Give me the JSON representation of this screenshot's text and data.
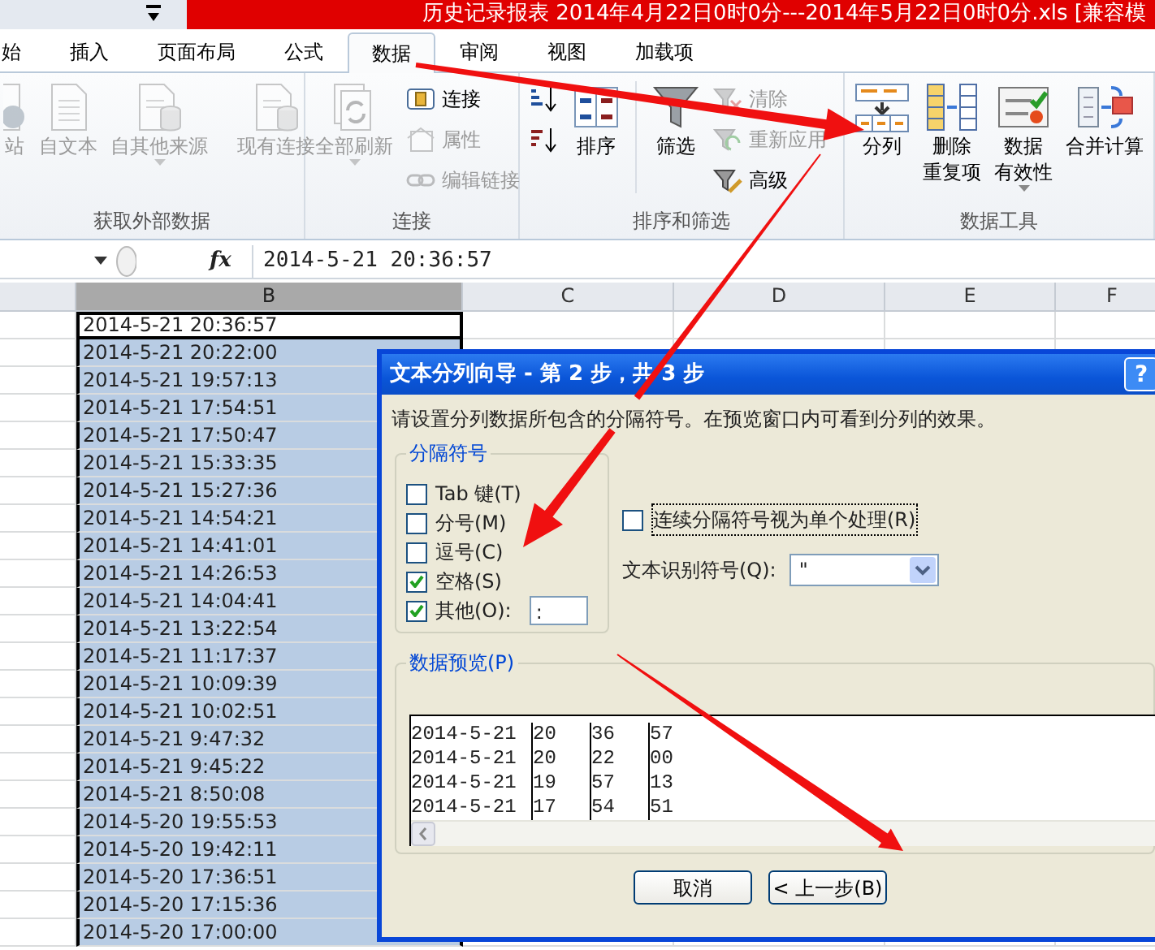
{
  "title_bar": {
    "title": "历史记录报表 2014年4月22日0时0分---2014年5月22日0时0分.xls",
    "mode": "[兼容模"
  },
  "tabs": [
    {
      "label": "始",
      "selected": false
    },
    {
      "label": "插入",
      "selected": false
    },
    {
      "label": "页面布局",
      "selected": false
    },
    {
      "label": "公式",
      "selected": false
    },
    {
      "label": "数据",
      "selected": true
    },
    {
      "label": "审阅",
      "selected": false
    },
    {
      "label": "视图",
      "selected": false
    },
    {
      "label": "加载项",
      "selected": false
    }
  ],
  "ribbon_groups": [
    {
      "title": "获取外部数据",
      "items": [
        {
          "kind": "large",
          "lines": [
            "站"
          ],
          "disabled": true
        },
        {
          "kind": "large",
          "lines": [
            "自文本"
          ],
          "disabled": true
        },
        {
          "kind": "large",
          "lines": [
            "自其他来源"
          ],
          "disabled": true,
          "dropdown": true
        },
        {
          "kind": "separator"
        },
        {
          "kind": "large",
          "lines": [
            "现有连接"
          ],
          "disabled": true
        }
      ]
    },
    {
      "title": "连接",
      "items": [
        {
          "kind": "large",
          "lines": [
            "全部刷新"
          ],
          "disabled": true,
          "dropdown": true
        },
        {
          "kind": "stack",
          "items": [
            {
              "label": "连接",
              "disabled": false
            },
            {
              "label": "属性",
              "disabled": true
            },
            {
              "label": "编辑链接",
              "disabled": true
            }
          ]
        }
      ]
    },
    {
      "title": "排序和筛选",
      "items": [
        {
          "kind": "stack",
          "items": [
            {
              "disabled": false
            },
            {
              "disabled": false
            }
          ]
        },
        {
          "kind": "large",
          "lines": [
            "排序"
          ],
          "disabled": false
        },
        {
          "kind": "separator"
        },
        {
          "kind": "large",
          "lines": [
            "筛选"
          ],
          "disabled": false
        },
        {
          "kind": "stack",
          "items": [
            {
              "label": "清除",
              "disabled": true
            },
            {
              "label": "重新应用",
              "disabled": true
            },
            {
              "label": "高级",
              "disabled": false
            }
          ]
        }
      ]
    },
    {
      "title": "数据工具",
      "items": [
        {
          "kind": "large",
          "lines": [
            "分列"
          ],
          "disabled": false
        },
        {
          "kind": "large",
          "lines": [
            "删除",
            "重复项"
          ],
          "disabled": false
        },
        {
          "kind": "large",
          "lines": [
            "数据",
            "有效性"
          ],
          "disabled": false,
          "dropdown": true
        },
        {
          "kind": "large",
          "lines": [
            "合并计算"
          ],
          "disabled": false
        }
      ]
    }
  ],
  "formula_bar": {
    "fx": "fx",
    "value": "2014-5-21 20:36:57"
  },
  "columns": [
    {
      "label": "B",
      "selected": true
    },
    {
      "label": "C",
      "selected": false
    },
    {
      "label": "D",
      "selected": false
    },
    {
      "label": "E",
      "selected": false
    },
    {
      "label": "F",
      "selected": false
    }
  ],
  "rows": [
    {
      "value": "2014-5-21 20:36:57",
      "selected": false
    },
    {
      "value": "2014-5-21 20:22:00",
      "selected": true
    },
    {
      "value": "2014-5-21 19:57:13",
      "selected": true
    },
    {
      "value": "2014-5-21 17:54:51",
      "selected": true
    },
    {
      "value": "2014-5-21 17:50:47",
      "selected": true
    },
    {
      "value": "2014-5-21 15:33:35",
      "selected": true
    },
    {
      "value": "2014-5-21 15:27:36",
      "selected": true
    },
    {
      "value": "2014-5-21 14:54:21",
      "selected": true
    },
    {
      "value": "2014-5-21 14:41:01",
      "selected": true
    },
    {
      "value": "2014-5-21 14:26:53",
      "selected": true
    },
    {
      "value": "2014-5-21 14:04:41",
      "selected": true
    },
    {
      "value": "2014-5-21 13:22:54",
      "selected": true
    },
    {
      "value": "2014-5-21 11:17:37",
      "selected": true
    },
    {
      "value": "2014-5-21 10:09:39",
      "selected": true
    },
    {
      "value": "2014-5-21 10:02:51",
      "selected": true
    },
    {
      "value": "2014-5-21 9:47:32",
      "selected": true
    },
    {
      "value": "2014-5-21 9:45:22",
      "selected": true
    },
    {
      "value": "2014-5-21 8:50:08",
      "selected": true
    },
    {
      "value": "2014-5-20 19:55:53",
      "selected": true
    },
    {
      "value": "2014-5-20 19:42:11",
      "selected": true
    },
    {
      "value": "2014-5-20 17:36:51",
      "selected": true
    },
    {
      "value": "2014-5-20 17:15:36",
      "selected": true
    },
    {
      "value": "2014-5-20 17:00:00",
      "selected": true
    }
  ],
  "dialog": {
    "title": "文本分列向导 - 第 2 步，共 3 步",
    "help": "?",
    "instruction": "请设置分列数据所包含的分隔符号。在预览窗口内可看到分列的效果。",
    "delimiters": {
      "legend": "分隔符号",
      "options": [
        {
          "label": "Tab 键(T)",
          "checked": false
        },
        {
          "label": "分号(M)",
          "checked": false
        },
        {
          "label": "逗号(C)",
          "checked": false
        },
        {
          "label": "空格(S)",
          "checked": true
        },
        {
          "label": "其他(O):",
          "checked": true,
          "value": ":"
        }
      ]
    },
    "consecutive": {
      "label": "连续分隔符号视为单个处理(R)",
      "checked": false
    },
    "qualifier": {
      "label": "文本识别符号(Q):",
      "value": "\""
    },
    "preview": {
      "legend": "数据预览(P)",
      "rows": [
        [
          "2014-5-21",
          "20",
          "36",
          "57"
        ],
        [
          "2014-5-21",
          "20",
          "22",
          "00"
        ],
        [
          "2014-5-21",
          "19",
          "57",
          "13"
        ],
        [
          "2014-5-21",
          "17",
          "54",
          "51"
        ]
      ]
    },
    "buttons": [
      "取消",
      "< 上一步(B)"
    ]
  }
}
